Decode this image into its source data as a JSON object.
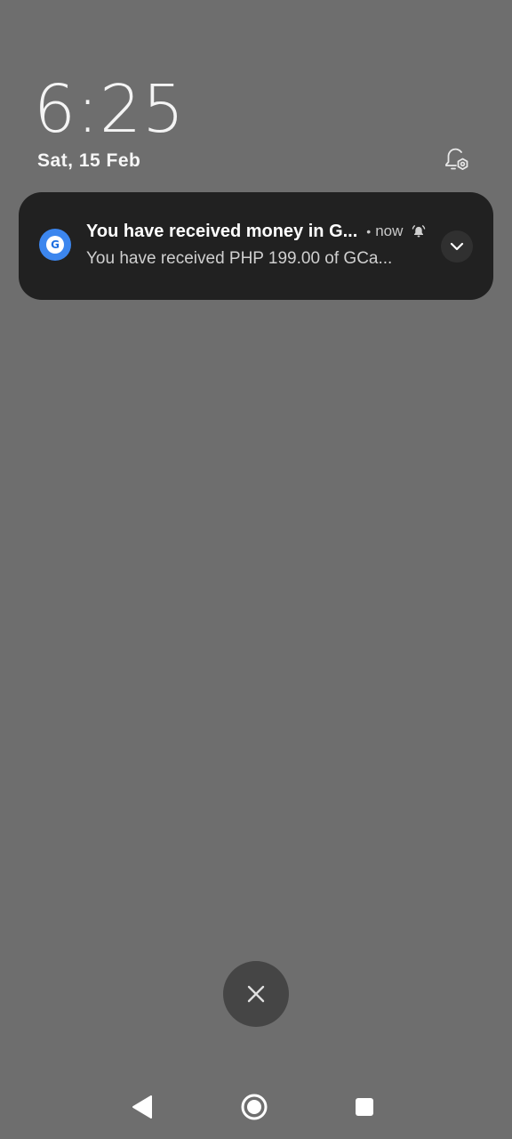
{
  "lockscreen": {
    "time": "6:25",
    "date": "Sat, 15 Feb"
  },
  "notification": {
    "app_icon": "gcash-app-icon",
    "app_icon_letter": "G",
    "title": "You have received money in G...",
    "separator": "•",
    "time": "now",
    "alert_icon": "bell-alert-icon",
    "body": "You have received PHP 199.00 of GCa...",
    "expand_icon": "chevron-down-icon"
  },
  "icons": {
    "notification_settings": "bell-settings-icon",
    "clear_all": "close-icon",
    "nav_back": "back-triangle-icon",
    "nav_home": "home-circle-icon",
    "nav_recents": "recents-square-icon"
  },
  "colors": {
    "background": "#6e6e6e",
    "card": "#212121",
    "accent": "#3c86ee"
  }
}
